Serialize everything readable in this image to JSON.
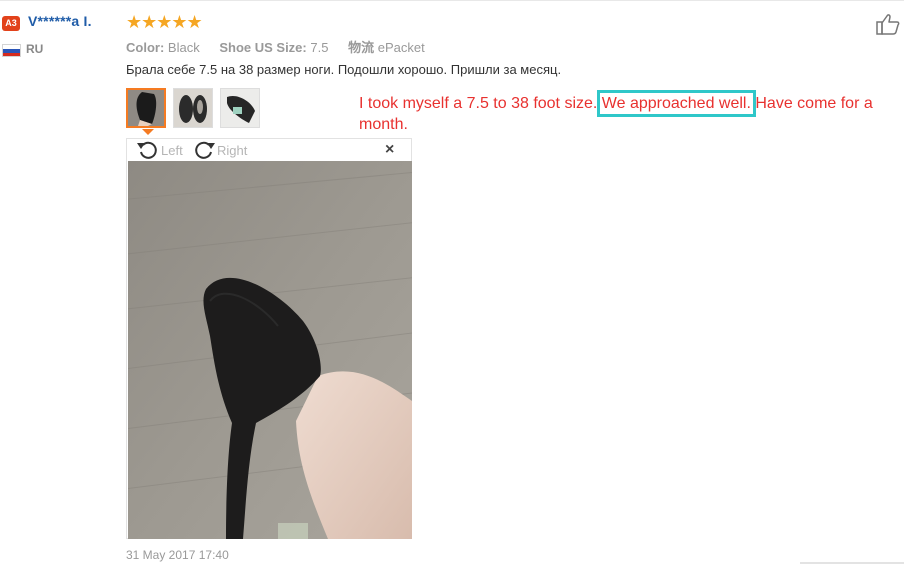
{
  "reviewer": {
    "level_badge": "A3",
    "name": "V******a I.",
    "country_code": "RU"
  },
  "review": {
    "stars": "★★★★★",
    "rating": 5,
    "attributes": [
      {
        "label": "Color:",
        "value": "Black"
      },
      {
        "label": "Shoe US Size:",
        "value": "7.5"
      },
      {
        "label": "物流",
        "value": "ePacket"
      }
    ],
    "text": "Брала себе 7.5 на 38 размер ноги. Подошли хорошо. Пришли за месяц.",
    "date": "31 May 2017 17:40"
  },
  "viewer": {
    "rotate_left_label": "Left",
    "rotate_right_label": "Right",
    "close_label": "×"
  },
  "translation": {
    "part1": "I took myself a 7.5 to 38 foot size. ",
    "highlight": "We approached well.",
    "part2": " Have come for a month."
  },
  "colors": {
    "accent": "#f57b22",
    "stars": "#f5a623",
    "username": "#1f5ca8",
    "translation": "#e8312f",
    "highlight_box": "#2fc7c9"
  }
}
